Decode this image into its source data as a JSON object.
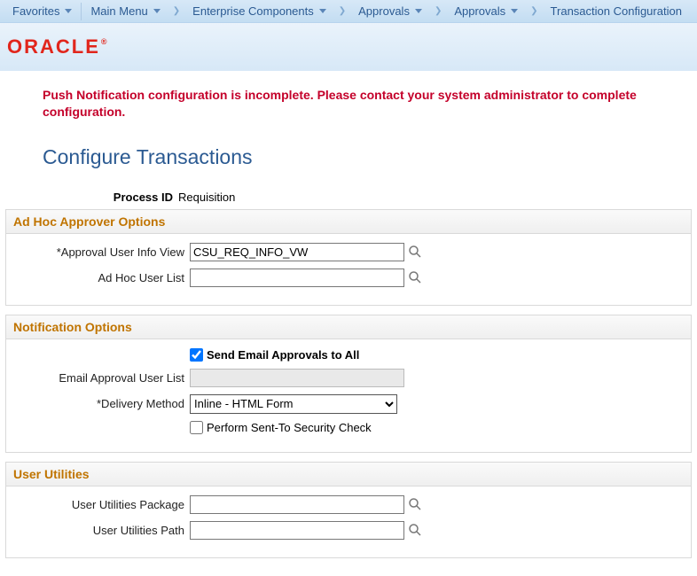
{
  "nav": {
    "favorites": "Favorites",
    "main_menu": "Main Menu",
    "crumbs": [
      "Enterprise Components",
      "Approvals",
      "Approvals",
      "Transaction Configuration"
    ]
  },
  "logo_text": "ORACLE",
  "alert_text": "Push Notification configuration is incomplete. Please contact your system administrator to complete configuration.",
  "page_title": "Configure Transactions",
  "process_id_label": "Process ID",
  "process_id_value": "Requisition",
  "sections": {
    "adhoc": {
      "title": "Ad Hoc Approver Options",
      "approval_view_label": "*Approval User Info View",
      "approval_view_value": "CSU_REQ_INFO_VW",
      "adhoc_user_list_label": "Ad Hoc User List",
      "adhoc_user_list_value": ""
    },
    "notif": {
      "title": "Notification Options",
      "send_all_label": "Send Email Approvals to All",
      "send_all_checked": true,
      "email_user_list_label": "Email Approval User List",
      "email_user_list_value": "",
      "delivery_label": "*Delivery Method",
      "delivery_value": "Inline - HTML Form",
      "security_check_label": "Perform Sent-To Security Check",
      "security_check_checked": false
    },
    "util": {
      "title": "User Utilities",
      "package_label": "User Utilities Package",
      "package_value": "",
      "path_label": "User Utilities Path",
      "path_value": ""
    }
  }
}
